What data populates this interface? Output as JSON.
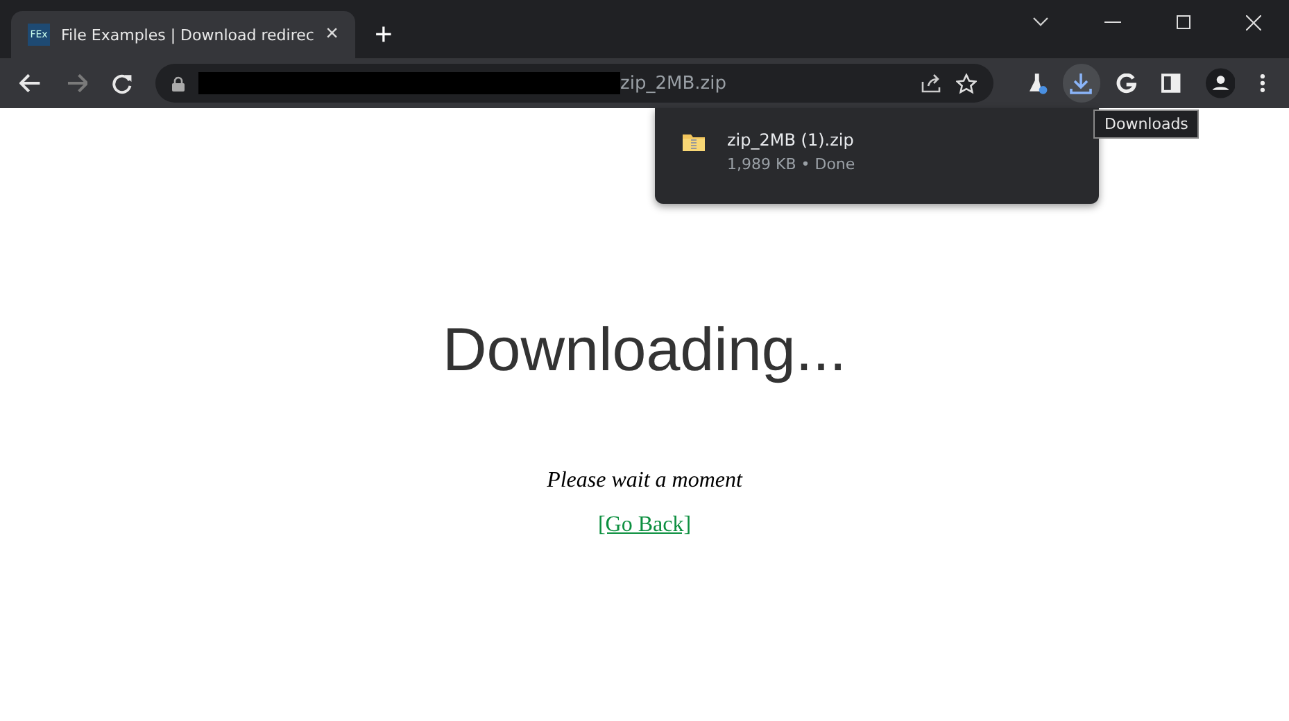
{
  "tab": {
    "favicon": "FEx",
    "title": "File Examples | Download redirec",
    "close": "×"
  },
  "new_tab": "+",
  "toolbar": {
    "back_disabled": false,
    "forward_disabled": true,
    "url_visible": "zip_2MB.zip",
    "downloads_active": true
  },
  "tooltip": "Downloads",
  "downloads_popup": {
    "items": [
      {
        "name": "zip_2MB (1).zip",
        "status": "1,989 KB • Done"
      }
    ]
  },
  "page": {
    "heading": "Downloading...",
    "message": "Please wait a moment",
    "link": "[Go Back]"
  }
}
